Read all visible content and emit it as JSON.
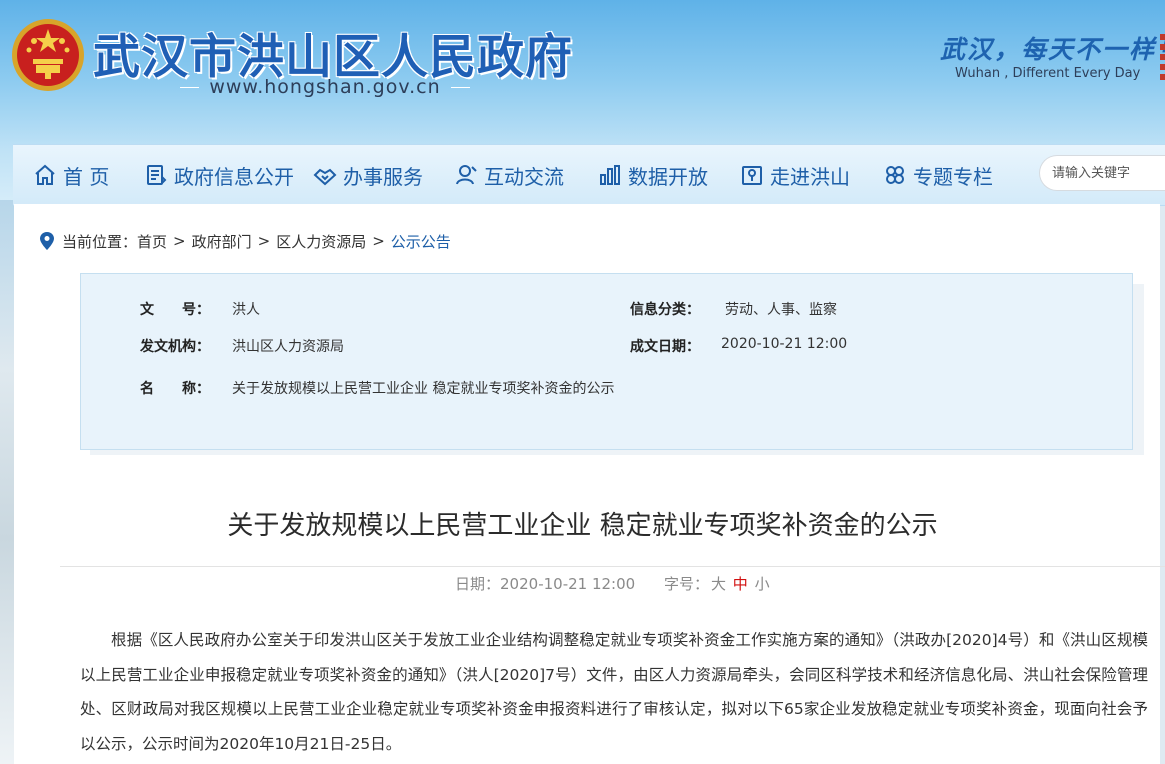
{
  "header": {
    "site_title": "武汉市洪山区人民政府",
    "site_url": "www.hongshan.gov.cn",
    "slogan": "武汉，每天不一样！",
    "slogan_en": "Wuhan , Different Every Day"
  },
  "nav": {
    "items": [
      {
        "label": "首 页",
        "icon": "home-icon"
      },
      {
        "label": "政府信息公开",
        "icon": "document-icon"
      },
      {
        "label": "办事服务",
        "icon": "handshake-icon"
      },
      {
        "label": "互动交流",
        "icon": "user-icon"
      },
      {
        "label": "数据开放",
        "icon": "bar-chart-icon"
      },
      {
        "label": "走进洪山",
        "icon": "map-icon"
      },
      {
        "label": "专题专栏",
        "icon": "clover-icon"
      }
    ],
    "search_placeholder": "请输入关键字"
  },
  "breadcrumb": {
    "prefix": "当前位置：",
    "items": [
      "首页",
      "政府部门",
      "区人力资源局",
      "公示公告"
    ],
    "separator": ">"
  },
  "info": {
    "doc_no_label": "文　　号：",
    "doc_no": "洪人",
    "category_label": "信息分类：",
    "category": "劳动、人事、监察",
    "issuer_label": "发文机构：",
    "issuer": "洪山区人力资源局",
    "date_label": "成文日期：",
    "date": "2020-10-21 12:00",
    "name_label": "名　　称：",
    "name": "关于发放规模以上民营工业企业 稳定就业专项奖补资金的公示"
  },
  "article": {
    "title": "关于发放规模以上民营工业企业 稳定就业专项奖补资金的公示",
    "date_label": "日期：",
    "date": "2020-10-21 12:00",
    "font_size_label": "字号：",
    "font_sizes": [
      "大",
      "中",
      "小"
    ],
    "selected_font_size": "中",
    "body": "根据《区人民政府办公室关于印发洪山区关于发放工业企业结构调整稳定就业专项奖补资金工作实施方案的通知》（洪政办[2020]4号）和《洪山区规模以上民营工业企业申报稳定就业专项奖补资金的通知》（洪人[2020]7号）文件，由区人力资源局牵头，会同区科学技术和经济信息化局、洪山社会保险管理处、区财政局对我区规模以上民营工业企业稳定就业专项奖补资金申报资料进行了审核认定，拟对以下65家企业发放稳定就业专项奖补资金，现面向社会予以公示，公示时间为2020年10月21日-25日。"
  },
  "colors": {
    "accent": "#1e5fa8",
    "highlight": "#d10f0f"
  }
}
